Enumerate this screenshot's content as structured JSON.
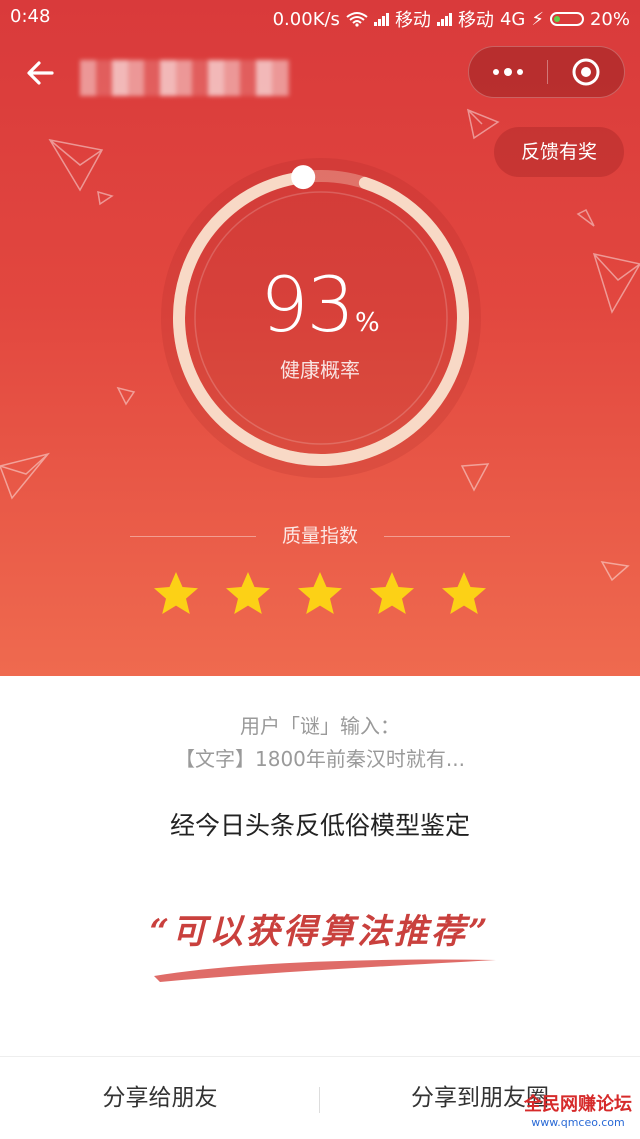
{
  "status_bar": {
    "time": "0:48",
    "speed": "0.00K/s",
    "carrier1": "移动",
    "carrier2": "移动",
    "network": "4G",
    "battery": "20%"
  },
  "nav": {
    "title_blurred": "",
    "capsule_more_icon": "more-dots-icon",
    "capsule_close_icon": "target-icon"
  },
  "feedback_button": "反馈有奖",
  "score": {
    "value": "93",
    "unit": "%",
    "label": "健康概率",
    "progress": 0.93
  },
  "quality": {
    "label": "质量指数",
    "stars_filled": 5,
    "stars_total": 5
  },
  "content": {
    "user_line": "用户「谜」输入：",
    "text_line": "【文字】1800年前秦汉时就有...",
    "verdict": "经今日头条反低俗模型鉴定",
    "slogan": "“可以获得算法推荐”"
  },
  "footer": {
    "share_friend": "分享给朋友",
    "share_moments": "分享到朋友圈"
  },
  "watermark": {
    "text": "全民网赚论坛",
    "domain": "www.qmceo.com"
  },
  "colors": {
    "hero_top": "#d93a3b",
    "hero_bottom": "#ef6a4f",
    "ring": "#f8d9c6",
    "star": "#fcd116",
    "slogan": "#c9403d"
  }
}
